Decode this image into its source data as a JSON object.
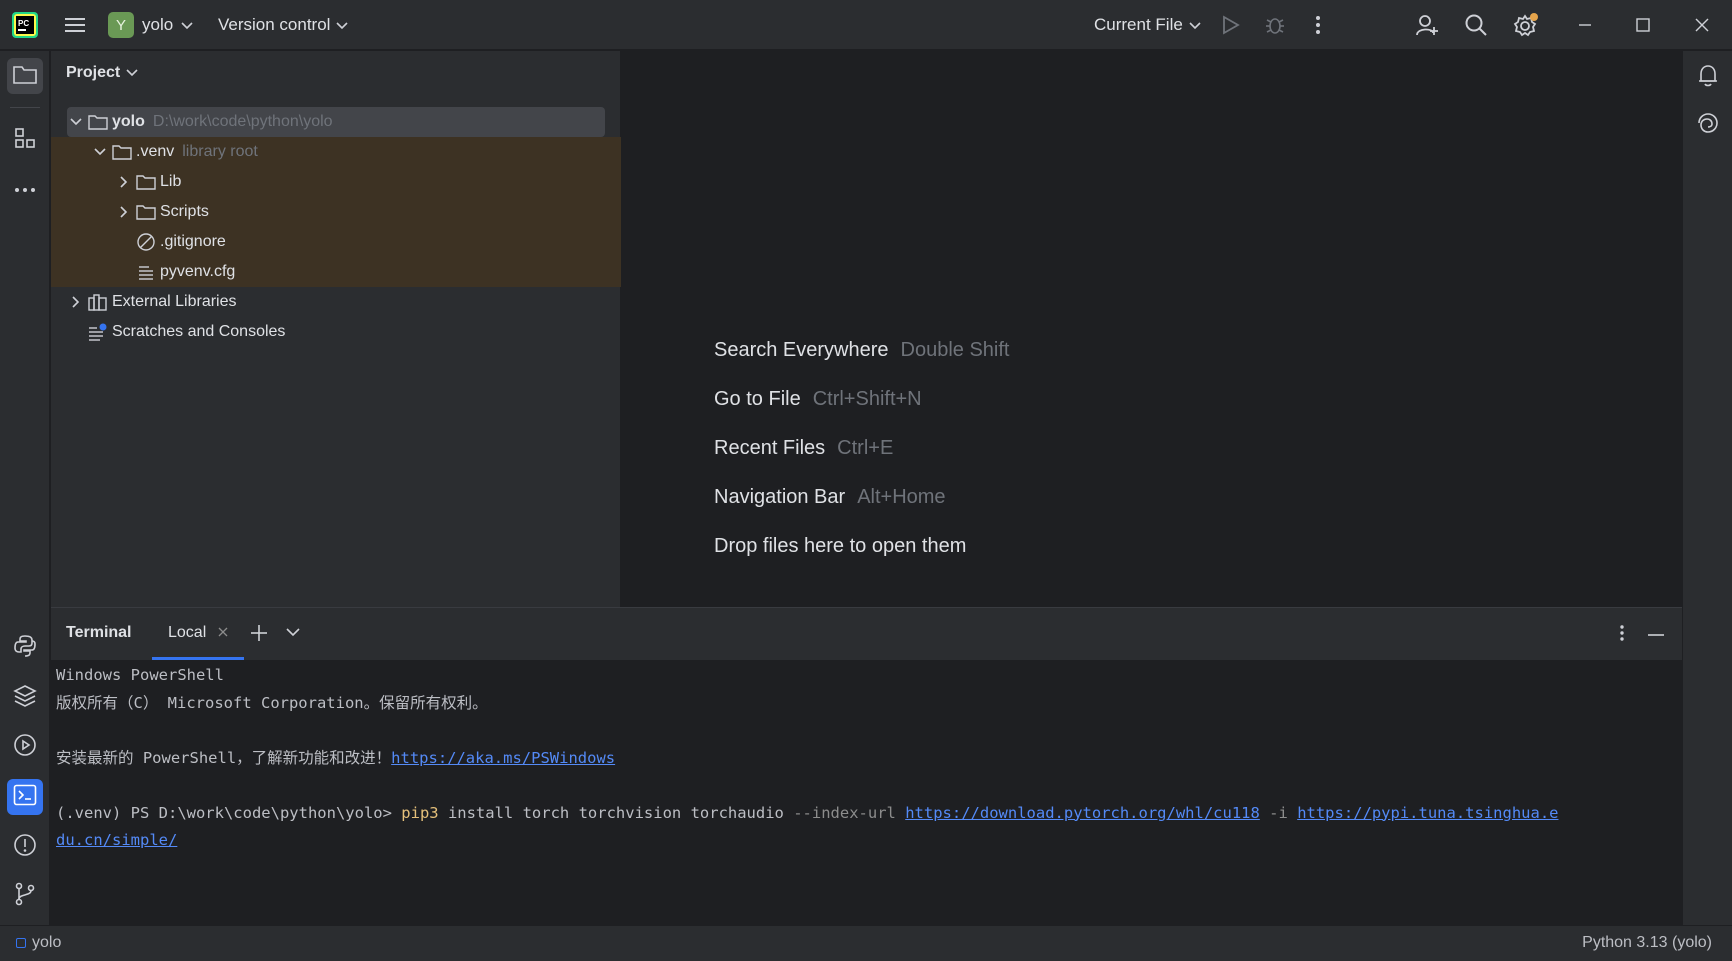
{
  "titlebar": {
    "project_initial": "Y",
    "project_name": "yolo",
    "vcs_label": "Version control",
    "run_config": "Current File"
  },
  "project_panel": {
    "title": "Project",
    "tree": [
      {
        "name": "yolo",
        "hint": "D:\\work\\code\\python\\yolo"
      },
      {
        "name": ".venv",
        "hint": "library root"
      },
      {
        "name": "Lib"
      },
      {
        "name": "Scripts"
      },
      {
        "name": ".gitignore"
      },
      {
        "name": "pyvenv.cfg"
      },
      {
        "name": "External Libraries"
      },
      {
        "name": "Scratches and Consoles"
      }
    ]
  },
  "editor": {
    "hints": [
      {
        "label": "Search Everywhere",
        "shortcut": "Double Shift"
      },
      {
        "label": "Go to File",
        "shortcut": "Ctrl+Shift+N"
      },
      {
        "label": "Recent Files",
        "shortcut": "Ctrl+E"
      },
      {
        "label": "Navigation Bar",
        "shortcut": "Alt+Home"
      },
      {
        "label": "Drop files here to open them",
        "shortcut": ""
      }
    ]
  },
  "terminal": {
    "title": "Terminal",
    "tab": "Local",
    "line1": "Windows PowerShell",
    "line2": "版权所有（C） Microsoft Corporation。保留所有权利。",
    "line3_text": "安装最新的 PowerShell，了解新功能和改进！",
    "line3_link": "https://aka.ms/PSWindows",
    "prompt": "(.venv) PS D:\\work\\code\\python\\yolo> ",
    "cmd": "pip3",
    "args": " install torch torchvision torchaudio ",
    "flag1": "--index-url",
    "url1": "https://download.pytorch.org/whl/cu118",
    "flag2": "-i",
    "url2_part1": "https://pypi.tuna.tsinghua.e",
    "url2_part2": "du.cn/simple/"
  },
  "statusbar": {
    "project": "yolo",
    "interpreter": "Python 3.13 (yolo)"
  },
  "colors": {
    "accent": "#3574f0",
    "background": "#1e1f22",
    "panel": "#2b2d30",
    "library_highlight": "#3d3223",
    "link": "#548af7"
  },
  "icons": [
    "pycharm-logo",
    "hamburger-menu-icon",
    "chevron-down-icon",
    "run-icon",
    "debug-icon",
    "more-vertical-icon",
    "add-user-icon",
    "search-icon",
    "settings-icon",
    "minimize-icon",
    "maximize-icon",
    "close-icon",
    "folder-icon",
    "structure-icon",
    "more-horizontal-icon",
    "python-console-icon",
    "layers-icon",
    "services-icon",
    "terminal-icon",
    "problems-icon",
    "git-icon",
    "bell-icon",
    "ai-assistant-icon"
  ]
}
